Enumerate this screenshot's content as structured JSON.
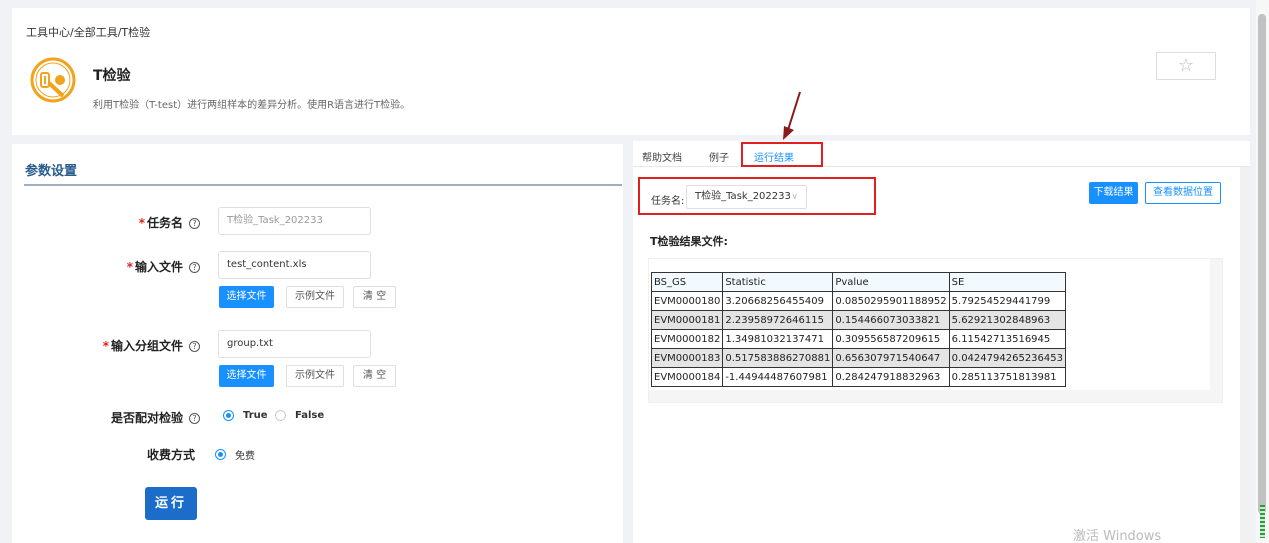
{
  "header": {
    "breadcrumb": "工具中心/全部工具/T检验",
    "title": "T检验",
    "description": "利用T检验（T-test）进行两组样本的差异分析。使用R语言进行T检验。",
    "star_icon": "☆"
  },
  "params": {
    "panel_title": "参数设置",
    "task_name": {
      "label": "任务名",
      "value": "T检验_Task_202233"
    },
    "input_file": {
      "label": "输入文件",
      "value": "test_content.xls"
    },
    "group_file": {
      "label": "输入分组文件",
      "value": "group.txt"
    },
    "file_buttons": {
      "choose": "选择文件",
      "example": "示例文件",
      "clear": "清 空"
    },
    "paired": {
      "label": "是否配对检验",
      "options": [
        "True",
        "False"
      ],
      "selected": "True"
    },
    "charge": {
      "label": "收费方式",
      "option": "免费"
    },
    "run_button": "运行"
  },
  "results": {
    "tabs": [
      "帮助文档",
      "例子",
      "运行结果"
    ],
    "active_tab": "运行结果",
    "task_label": "任务名:",
    "task_select": "T检验_Task_202233",
    "download_button": "下载结果",
    "location_button": "查看数据位置",
    "file_heading": "T检验结果文件:",
    "table": {
      "columns": [
        "BS_GS",
        "Statistic",
        "Pvalue",
        "SE"
      ],
      "rows": [
        [
          "EVM0000180",
          "3.20668256455409",
          "0.0850295901188952",
          "5.79254529441799"
        ],
        [
          "EVM0000181",
          "2.23958972646115",
          "0.154466073033821",
          "5.62921302848963"
        ],
        [
          "EVM0000182",
          "1.34981032137471",
          "0.309556587209615",
          "6.11542713516945"
        ],
        [
          "EVM0000183",
          "0.517583886270881",
          "0.656307971540647",
          "0.0424794265236453"
        ],
        [
          "EVM0000184",
          "-1.44944487607981",
          "0.284247918832963",
          "0.285113751813981"
        ]
      ]
    }
  },
  "watermark": "激活 Windows",
  "colors": {
    "primary": "#1890ff",
    "run": "#1b6dc9",
    "annotation": "#e02020"
  }
}
